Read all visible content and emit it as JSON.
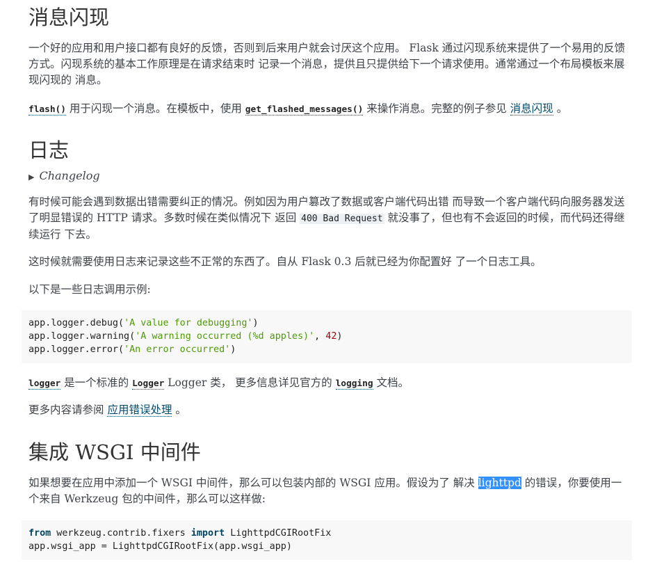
{
  "section_flash": {
    "title": "消息闪现",
    "p1": "一个好的应用和用户接口都有良好的反馈，否则到后来用户就会讨厌这个应用。 Flask 通过闪现系统来提供了一个易用的反馈方式。闪现系统的基本工作原理是在请求结束时 记录一个消息，提供且只提供给下一个请求使用。通常通过一个布局模板来展现闪现的 消息。",
    "p2": {
      "func1": "flash()",
      "t1": " 用于闪现一个消息。在模板中，使用 ",
      "func2": "get_flashed_messages()",
      "t2": " 来操作消息。完整的例子参见 ",
      "link": "消息闪现",
      "t3": " 。"
    }
  },
  "section_logging": {
    "title": "日志",
    "changelog_label": "Changelog",
    "p3": {
      "t1": "有时候可能会遇到数据出错需要纠正的情况。例如因为用户篡改了数据或客户端代码出错 而导致一个客户端代码向服务器发送了明显错误的 HTTP 请求。多数时候在类似情况下 返回 ",
      "code": "400 Bad Request",
      "t2": " 就没事了，但也有不会返回的时候，而代码还得继续运行 下去。"
    },
    "p4": "这时候就需要使用日志来记录这些不正常的东西了。自从 Flask 0.3 后就已经为你配置好 了一个日志工具。",
    "p5": "以下是一些日志调用示例:",
    "code_lines": [
      {
        "pre": "app.logger.debug(",
        "str": "'A value for debugging'",
        "post": ")"
      },
      {
        "pre": "app.logger.warning(",
        "str": "'A warning occurred (%d apples)'",
        "mid": ", ",
        "num": "42",
        "post": ")"
      },
      {
        "pre": "app.logger.error(",
        "str": "'An error occurred'",
        "post": ")"
      }
    ],
    "p6": {
      "x1": "logger",
      "t1": " 是一个标准的 ",
      "x2": "Logger",
      "t2": " Logger 类， 更多信息详见官方的 ",
      "x3": "logging",
      "t3": " 文档。"
    },
    "p7": {
      "t1": "更多内容请参阅 ",
      "link": "应用错误处理",
      "t2": " 。"
    }
  },
  "section_wsgi": {
    "title": "集成 WSGI 中间件",
    "p8": {
      "t1": "如果想要在应用中添加一个 WSGI 中间件，那么可以包装内部的 WSGI 应用。假设为了 解决 ",
      "highlight": "lighttpd",
      "t2": " 的错误，你要使用一个来自 Werkzeug 包的中间件，那么可以这样做:"
    },
    "code": {
      "kw1": "from",
      "mod": " werkzeug.contrib.fixers ",
      "kw2": "import",
      "cls": " LighttpdCGIRootFix",
      "line2": "app.wsgi_app = LighttpdCGIRootFix(app.wsgi_app)"
    }
  }
}
